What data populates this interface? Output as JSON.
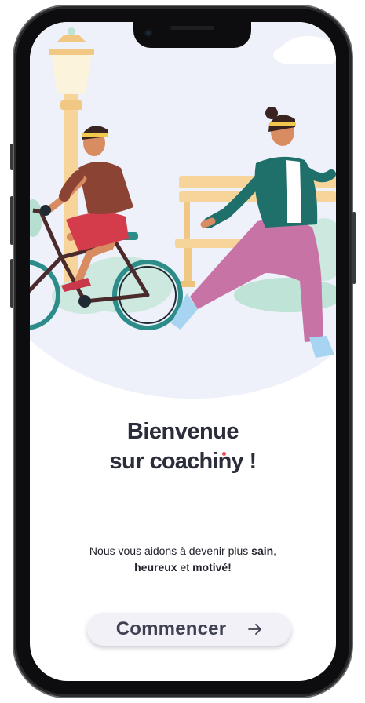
{
  "welcome": {
    "line1": "Bienvenue",
    "line2_prefix": "sur ",
    "brand": "coachiny",
    "line2_suffix": " !"
  },
  "tagline": {
    "text1": "Nous vous aidons à devenir plus ",
    "bold1": "sain",
    "text2": ",",
    "bold2": "heureux",
    "text3": " et ",
    "bold3": "motivé!"
  },
  "cta": {
    "label": "Commencer",
    "icon": "arrow-right-icon"
  },
  "colors": {
    "background_blob": "#eef0fa",
    "title": "#2b2d3b",
    "cta_background": "#f1f1f7",
    "brand_dot": "#e8505b"
  }
}
